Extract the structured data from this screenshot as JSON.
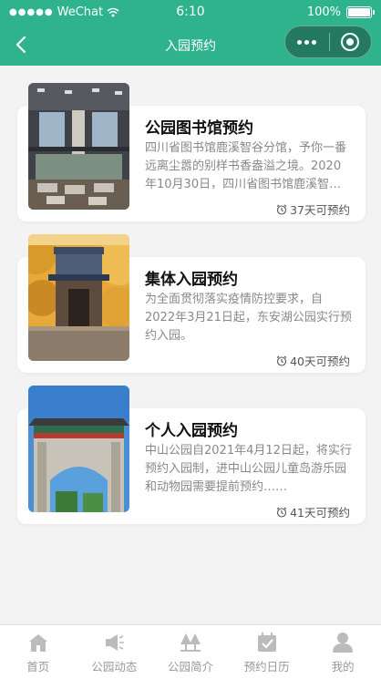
{
  "status_bar": {
    "carrier": "WeChat",
    "time": "6:10",
    "battery": "100%"
  },
  "nav": {
    "title": "入园预约"
  },
  "cards": [
    {
      "title": "公园图书馆预约",
      "description": "四川省图书馆鹿溪智谷分馆，予你一番远离尘嚣的别样书香盎溢之境。2020年10月30日，四川省图书馆鹿溪智谷分馆正式开馆……",
      "meta": "37天可预约"
    },
    {
      "title": "集体入园预约",
      "description": "为全面贯彻落实疫情防控要求，自2022年3月21日起，东安湖公园实行预约入园。",
      "meta": "40天可预约"
    },
    {
      "title": "个人入园预约",
      "description": "中山公园自2021年4月12日起，将实行预约入园制，进中山公园儿童岛游乐园和动物园需要提前预约……",
      "meta": "41天可预约"
    }
  ],
  "tab_bar": {
    "items": [
      {
        "label": "首页",
        "icon": "home-icon"
      },
      {
        "label": "公园动态",
        "icon": "megaphone-icon"
      },
      {
        "label": "公园简介",
        "icon": "trees-icon"
      },
      {
        "label": "预约日历",
        "icon": "calendar-check-icon"
      },
      {
        "label": "我的",
        "icon": "user-icon"
      }
    ]
  },
  "colors": {
    "brand": "#2eb38c",
    "capsule": "#237a5e",
    "tab_inactive": "#999999"
  }
}
